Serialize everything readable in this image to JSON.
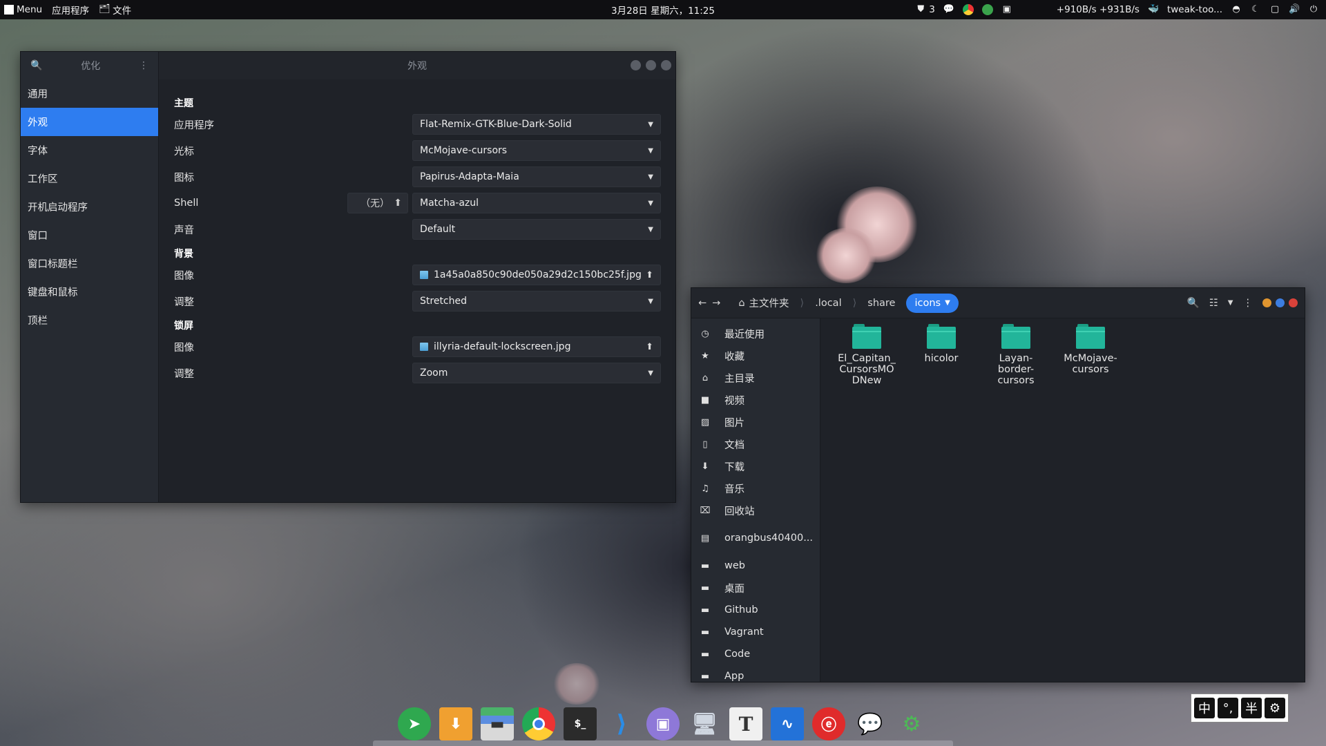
{
  "colors": {
    "accent": "#2e7df0",
    "folder": "#22b59a",
    "window_bg": "#1f2228",
    "sidebar_bg": "#262a31"
  },
  "topbar": {
    "menu_label": "Menu",
    "apps_label": "应用程序",
    "files_label": "文件",
    "datetime": "3月28日 星期六，11:25",
    "notify_count": "3",
    "net_speed": "+910B/s +931B/s",
    "active_app": "tweak-too..."
  },
  "tweaks": {
    "search_label": "优化",
    "title": "外观",
    "nav": [
      "通用",
      "外观",
      "字体",
      "工作区",
      "开机启动程序",
      "窗口",
      "窗口标题栏",
      "键盘和鼠标",
      "顶栏"
    ],
    "theme": {
      "title": "主题",
      "rows": [
        {
          "label": "应用程序",
          "value": "Flat-Remix-GTK-Blue-Dark-Solid"
        },
        {
          "label": "光标",
          "value": "McMojave-cursors"
        },
        {
          "label": "图标",
          "value": "Papirus-Adapta-Maia"
        },
        {
          "label": "Shell",
          "value": "Matcha-azul",
          "extra": "（无）"
        },
        {
          "label": "声音",
          "value": "Default"
        }
      ]
    },
    "background": {
      "title": "背景",
      "image_label": "图像",
      "image_value": "1a45a0a850c90de050a29d2c150bc25f.jpg",
      "adjust_label": "调整",
      "adjust_value": "Stretched"
    },
    "lockscreen": {
      "title": "锁屏",
      "image_label": "图像",
      "image_value": "illyria-default-lockscreen.jpg",
      "adjust_label": "调整",
      "adjust_value": "Zoom"
    }
  },
  "files": {
    "breadcrumb": [
      "主文件夹",
      ".local",
      "share",
      "icons"
    ],
    "places": [
      {
        "label": "最近使用",
        "icon": "clock-icon"
      },
      {
        "label": "收藏",
        "icon": "star-icon"
      },
      {
        "label": "主目录",
        "icon": "home-icon"
      },
      {
        "label": "视频",
        "icon": "video-icon"
      },
      {
        "label": "图片",
        "icon": "picture-icon"
      },
      {
        "label": "文档",
        "icon": "document-icon"
      },
      {
        "label": "下载",
        "icon": "download-icon"
      },
      {
        "label": "音乐",
        "icon": "music-icon"
      },
      {
        "label": "回收站",
        "icon": "trash-icon"
      },
      {
        "label": "orangbus40400...",
        "icon": "drive-icon"
      },
      {
        "label": "web",
        "icon": "folder-icon"
      },
      {
        "label": "桌面",
        "icon": "desktop-icon"
      },
      {
        "label": "Github",
        "icon": "folder-icon"
      },
      {
        "label": "Vagrant",
        "icon": "folder-icon"
      },
      {
        "label": "Code",
        "icon": "folder-icon"
      },
      {
        "label": "App",
        "icon": "folder-icon"
      }
    ],
    "items": [
      "El_Capitan_ CursorsMO DNew",
      "hicolor",
      "Layan- border- cursors",
      "McMojave- cursors"
    ]
  },
  "dock": [
    "telegram",
    "downloader",
    "files",
    "chrome",
    "terminal",
    "vscode",
    "disk-utility",
    "remote-desktop",
    "typora",
    "system-monitor",
    "netease-music",
    "wechat",
    "software-settings"
  ],
  "ime": {
    "keys": [
      "中",
      "°,",
      "半",
      "⚙"
    ]
  }
}
